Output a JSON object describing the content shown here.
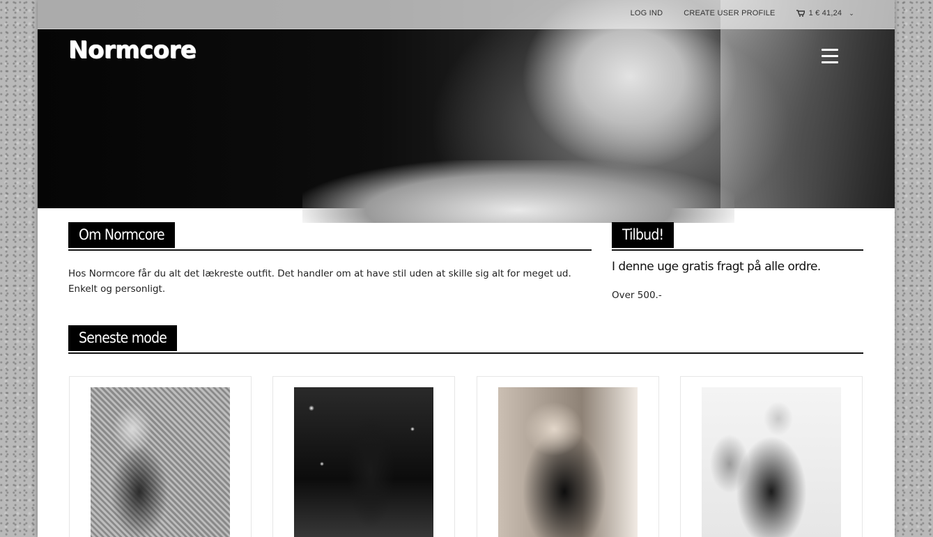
{
  "topbar": {
    "login": "LOG IND",
    "create_profile": "CREATE USER PROFILE",
    "cart": "1 € 41,24"
  },
  "header": {
    "logo": "Normcore"
  },
  "about": {
    "title": "Om Normcore",
    "text": "Hos Normcore får du alt det lækreste outfit. Det handler om at have stil uden at skille sig alt for meget ud. Enkelt og personligt."
  },
  "offer": {
    "title": "Tilbud!",
    "line1": "I denne uge gratis fragt på alle ordre.",
    "line2": "Over 500.-"
  },
  "latest": {
    "title": "Seneste mode"
  },
  "icons": [
    "cart-icon",
    "chevron-down-icon",
    "hamburger-menu-icon"
  ]
}
